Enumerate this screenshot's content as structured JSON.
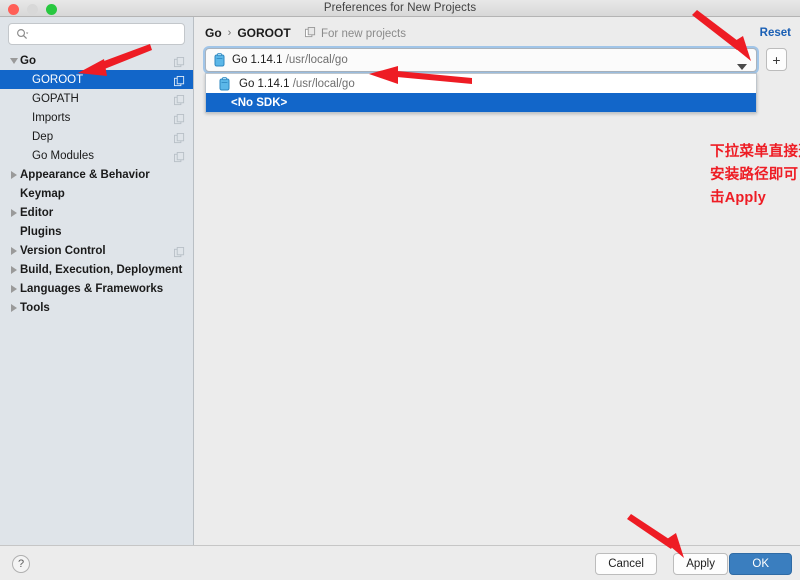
{
  "window": {
    "title": "Preferences for New Projects",
    "traffic_lights": [
      "close-red",
      "minimize-disabled",
      "zoom-green"
    ]
  },
  "sidebar": {
    "search": {
      "value": "",
      "placeholder": ""
    },
    "items": [
      {
        "label": "Go",
        "level": 0,
        "twisty": "down",
        "bold": true,
        "selected": false,
        "copy_icon": true
      },
      {
        "label": "GOROOT",
        "level": 1,
        "twisty": "none",
        "bold": false,
        "selected": true,
        "copy_icon": true
      },
      {
        "label": "GOPATH",
        "level": 1,
        "twisty": "none",
        "bold": false,
        "selected": false,
        "copy_icon": true
      },
      {
        "label": "Imports",
        "level": 1,
        "twisty": "none",
        "bold": false,
        "selected": false,
        "copy_icon": true
      },
      {
        "label": "Dep",
        "level": 1,
        "twisty": "none",
        "bold": false,
        "selected": false,
        "copy_icon": true
      },
      {
        "label": "Go Modules",
        "level": 1,
        "twisty": "none",
        "bold": false,
        "selected": false,
        "copy_icon": true
      },
      {
        "label": "Appearance & Behavior",
        "level": 0,
        "twisty": "right",
        "bold": true,
        "selected": false,
        "copy_icon": false
      },
      {
        "label": "Keymap",
        "level": 0,
        "twisty": "none",
        "bold": true,
        "selected": false,
        "copy_icon": false
      },
      {
        "label": "Editor",
        "level": 0,
        "twisty": "right",
        "bold": true,
        "selected": false,
        "copy_icon": false
      },
      {
        "label": "Plugins",
        "level": 0,
        "twisty": "none",
        "bold": true,
        "selected": false,
        "copy_icon": false
      },
      {
        "label": "Version Control",
        "level": 0,
        "twisty": "right",
        "bold": true,
        "selected": false,
        "copy_icon": true
      },
      {
        "label": "Build, Execution, Deployment",
        "level": 0,
        "twisty": "right",
        "bold": true,
        "selected": false,
        "copy_icon": false
      },
      {
        "label": "Languages & Frameworks",
        "level": 0,
        "twisty": "right",
        "bold": true,
        "selected": false,
        "copy_icon": false
      },
      {
        "label": "Tools",
        "level": 0,
        "twisty": "right",
        "bold": true,
        "selected": false,
        "copy_icon": false
      }
    ]
  },
  "pane": {
    "breadcrumb": {
      "root": "Go",
      "separator": "›",
      "current": "GOROOT"
    },
    "scope_label": "For new projects",
    "reset_label": "Reset",
    "combo": {
      "selected_name": "Go 1.14.1",
      "selected_path": "/usr/local/go",
      "add_button_label": "+"
    },
    "dropdown": {
      "open": true,
      "options": [
        {
          "name": "Go 1.14.1",
          "path": "/usr/local/go",
          "selected": false,
          "has_icon": true
        },
        {
          "name": "<No SDK>",
          "path": "",
          "selected": true,
          "has_icon": false
        }
      ]
    },
    "annotation": {
      "line1": "下拉菜单直接选择GO安装包的",
      "line2": "安装路径即可，选择完成后，点",
      "line3": "击Apply",
      "color": "#ee1c24"
    }
  },
  "bottom": {
    "help_label": "?",
    "cancel_label": "Cancel",
    "apply_label": "Apply",
    "ok_label": "OK"
  },
  "colors": {
    "selection_blue": "#1266c9",
    "ok_button_blue": "#3a7ebf",
    "link_blue": "#1a5fb4",
    "annotation_red": "#ee1c24",
    "sidebar_bg": "#dfe4e9",
    "pane_bg": "#ececec"
  },
  "annotation_arrows": [
    {
      "name": "arrow-to-goroot",
      "points_to": "GOROOT sidebar item"
    },
    {
      "name": "arrow-to-dropdown-item",
      "points_to": "Go 1.14.1 dropdown option"
    },
    {
      "name": "arrow-to-combo-caret",
      "points_to": "SDK combo box caret"
    },
    {
      "name": "arrow-to-apply",
      "points_to": "Apply button"
    }
  ]
}
